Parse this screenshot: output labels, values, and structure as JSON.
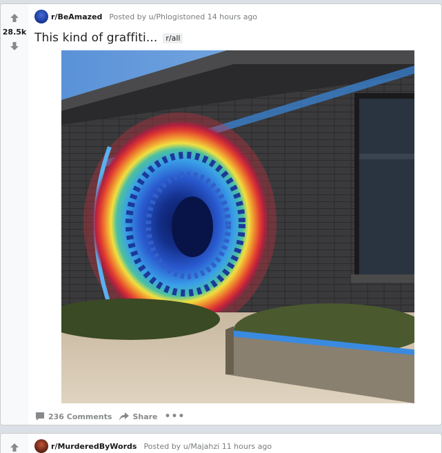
{
  "posts": [
    {
      "score": "28.5k",
      "subreddit": "r/BeAmazed",
      "posted_by": "Posted by u/Phlogistoned 14 hours ago",
      "title": "This kind of graffiti...",
      "flair": "r/all",
      "comments": "236 Comments",
      "share": "Share",
      "more": "•••"
    },
    {
      "subreddit": "r/MurderedByWords",
      "posted_by": "Posted by u/Majahzi 11 hours ago"
    }
  ],
  "colors": {
    "page_bg": "#dae0e6",
    "vote_rail_bg": "#f8f9fa",
    "arrow": "#878a8c",
    "meta_text": "#787c7e"
  },
  "icons": {
    "upvote": "upvote-arrow-icon",
    "downvote": "downvote-arrow-icon",
    "comments": "comment-bubble-icon",
    "share": "share-arrow-icon",
    "more": "more-dots-icon"
  }
}
